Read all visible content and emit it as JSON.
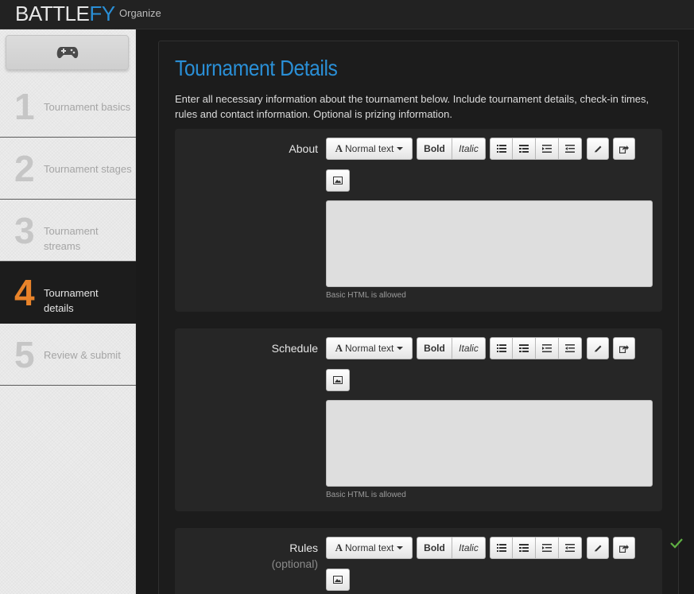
{
  "header": {
    "logo_part1": "BATTLE",
    "logo_part2": "FY",
    "nav_organize": "Organize"
  },
  "sidebar": {
    "game_icon": "gamepad-icon",
    "steps": [
      {
        "num": "1",
        "label": "Tournament basics",
        "active": false
      },
      {
        "num": "2",
        "label": "Tournament stages",
        "active": false
      },
      {
        "num": "3",
        "label": "Tournament streams",
        "active": false
      },
      {
        "num": "4",
        "label": "Tournament details",
        "active": true
      },
      {
        "num": "5",
        "label": "Review & submit",
        "active": false
      }
    ]
  },
  "main": {
    "title": "Tournament Details",
    "intro": "Enter all necessary information about the tournament below. Include tournament details, check-in times, rules and contact information. Optional is prizing information.",
    "toolbar": {
      "font_style_label": "Normal text",
      "bold_label": "Bold",
      "italic_label": "Italic",
      "icons": [
        "unordered-list-icon",
        "ordered-list-icon",
        "outdent-icon",
        "indent-icon",
        "pencil-icon",
        "share-link-icon",
        "image-icon"
      ]
    },
    "hint_text": "Basic HTML is allowed",
    "sections": [
      {
        "label": "About",
        "sublabel": "",
        "value": ""
      },
      {
        "label": "Schedule",
        "sublabel": "",
        "value": ""
      },
      {
        "label": "Rules",
        "sublabel": "(optional)",
        "value": ""
      }
    ]
  },
  "colors": {
    "accent_blue": "#2a8fd6",
    "accent_orange": "#e8832a",
    "check_green": "#5fb043"
  }
}
